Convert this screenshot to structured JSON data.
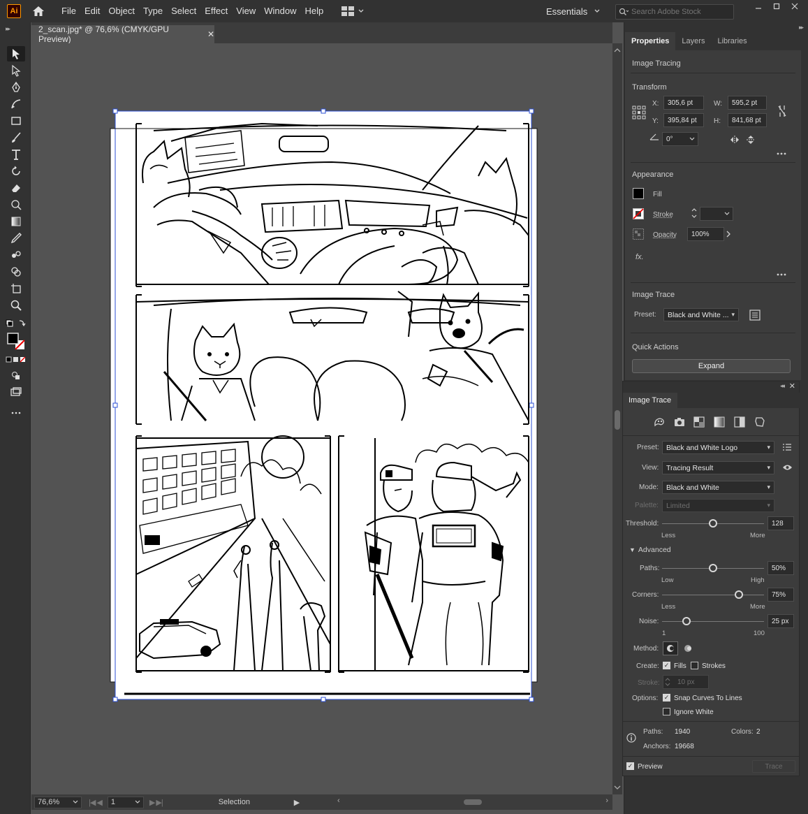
{
  "app": {
    "logo": "Ai"
  },
  "menu": [
    "File",
    "Edit",
    "Object",
    "Type",
    "Select",
    "Effect",
    "View",
    "Window",
    "Help"
  ],
  "workspace": {
    "label": "Essentials"
  },
  "search": {
    "placeholder": "Search Adobe Stock"
  },
  "document": {
    "tab_title": "2_scan.jpg* @ 76,6% (CMYK/GPU Preview)"
  },
  "status": {
    "zoom": "76,6%",
    "page": "1",
    "tool": "Selection"
  },
  "properties": {
    "tabs": [
      "Properties",
      "Layers",
      "Libraries"
    ],
    "object_type": "Image Tracing",
    "transform": {
      "title": "Transform",
      "x_label": "X:",
      "x": "305,6 pt",
      "y_label": "Y:",
      "y": "395,84 pt",
      "w_label": "W:",
      "w": "595,2 pt",
      "h_label": "H:",
      "h": "841,68 pt",
      "angle": "0°"
    },
    "appearance": {
      "title": "Appearance",
      "fill": "Fill",
      "stroke": "Stroke",
      "opacity": "Opacity",
      "opacity_value": "100%",
      "fx": "fx."
    },
    "image_trace": {
      "title": "Image Trace",
      "preset_label": "Preset:",
      "preset_value": "Black and White ..."
    },
    "quick_actions": {
      "title": "Quick Actions",
      "expand": "Expand"
    }
  },
  "trace_panel": {
    "title": "Image Trace",
    "preset": {
      "label": "Preset:",
      "value": "Black and White Logo"
    },
    "view": {
      "label": "View:",
      "value": "Tracing Result"
    },
    "mode": {
      "label": "Mode:",
      "value": "Black and White"
    },
    "palette": {
      "label": "Palette:",
      "value": "Limited"
    },
    "threshold": {
      "label": "Threshold:",
      "value": "128",
      "less": "Less",
      "more": "More",
      "level": 0.5
    },
    "advanced": "Advanced",
    "paths": {
      "label": "Paths:",
      "value": "50%",
      "low": "Low",
      "high": "High",
      "level": 0.5
    },
    "corners": {
      "label": "Corners:",
      "value": "75%",
      "less": "Less",
      "more": "More",
      "level": 0.75
    },
    "noise": {
      "label": "Noise:",
      "value": "25 px",
      "min": "1",
      "max": "100",
      "level": 0.24
    },
    "method": {
      "label": "Method:"
    },
    "create": {
      "label": "Create:",
      "fills": "Fills",
      "strokes": "Strokes",
      "fills_on": true,
      "strokes_on": false
    },
    "stroke": {
      "label": "Stroke:",
      "value": "10 px"
    },
    "options": {
      "label": "Options:",
      "snap": "Snap Curves To Lines",
      "ignore_white": "Ignore White"
    },
    "stats": {
      "paths_label": "Paths:",
      "paths": "1940",
      "colors_label": "Colors:",
      "colors": "2",
      "anchors_label": "Anchors:",
      "anchors": "19668"
    },
    "preview": "Preview",
    "trace_button": "Trace"
  }
}
